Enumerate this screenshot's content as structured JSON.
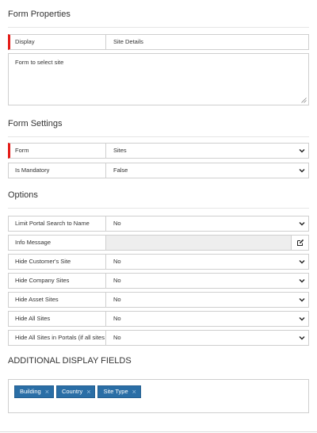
{
  "sections": {
    "form_properties": "Form Properties",
    "form_settings": "Form Settings",
    "options": "Options",
    "additional_display_fields": "ADDITIONAL DISPLAY FIELDS"
  },
  "form_properties": {
    "display_label": "Display",
    "display_value": "Site Details",
    "description": "Form to select site"
  },
  "form_settings": {
    "form_label": "Form",
    "form_value": "Sites",
    "mandatory_label": "Is Mandatory",
    "mandatory_value": "False"
  },
  "options": {
    "limit_portal_label": "Limit Portal Search to Name",
    "limit_portal_value": "No",
    "info_message_label": "Info Message",
    "info_message_value": "",
    "hide_customer_label": "Hide Customer's Site",
    "hide_customer_value": "No",
    "hide_company_label": "Hide Company Sites",
    "hide_company_value": "No",
    "hide_asset_label": "Hide Asset Sites",
    "hide_asset_value": "No",
    "hide_all_label": "Hide All Sites",
    "hide_all_value": "No",
    "hide_all_portals_label": "Hide All Sites in Portals (if all sites",
    "hide_all_portals_value": "No"
  },
  "additional_display_fields": {
    "tags": [
      "Building",
      "Country",
      "Site Type"
    ],
    "remove_glyph": "×"
  },
  "colors": {
    "required_marker": "#e41b17",
    "tag_background": "#2a6ea6"
  },
  "icons": {
    "dropdown": "chevron-down-icon",
    "edit": "edit-icon",
    "resize": "resize-handle-icon"
  }
}
